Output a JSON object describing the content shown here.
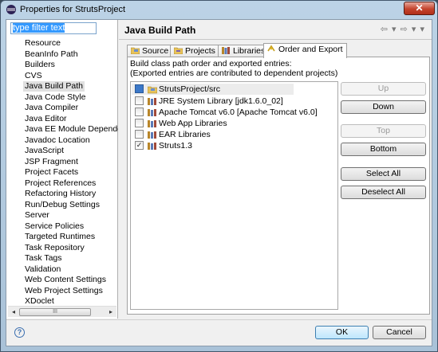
{
  "window": {
    "title": "Properties for StrutsProject",
    "close_glyph": "✕"
  },
  "filter": {
    "value": "type filter text"
  },
  "tree": {
    "items": [
      "Resource",
      "BeanInfo Path",
      "Builders",
      "CVS",
      "Java Build Path",
      "Java Code Style",
      "Java Compiler",
      "Java Editor",
      "Java EE Module Dependencies",
      "Javadoc Location",
      "JavaScript",
      "JSP Fragment",
      "Project Facets",
      "Project References",
      "Refactoring History",
      "Run/Debug Settings",
      "Server",
      "Service Policies",
      "Targeted Runtimes",
      "Task Repository",
      "Task Tags",
      "Validation",
      "Web Content Settings",
      "Web Project Settings",
      "XDoclet"
    ],
    "selected_index": 4
  },
  "scroll": {
    "left": "◂",
    "right": "▸",
    "grip": "III"
  },
  "page": {
    "title": "Java Build Path",
    "nav": "⇦ ▾ ⇨ ▾ ▾"
  },
  "tabs": [
    {
      "label": "Source",
      "icon": "source-folder-icon"
    },
    {
      "label": "Projects",
      "icon": "projects-icon"
    },
    {
      "label": "Libraries",
      "icon": "libraries-icon"
    },
    {
      "label": "Order and Export",
      "icon": "order-export-icon",
      "active": true
    }
  ],
  "description": {
    "line1": "Build class path order and exported entries:",
    "line2": "(Exported entries are contributed to dependent projects)"
  },
  "entries": [
    {
      "label": "StrutsProject/src",
      "icon": "source-folder-icon",
      "checked": true,
      "selected": true
    },
    {
      "label": "JRE System Library [jdk1.6.0_02]",
      "icon": "library-icon",
      "checked": false
    },
    {
      "label": "Apache Tomcat v6.0 [Apache Tomcat v6.0]",
      "icon": "library-icon",
      "checked": false
    },
    {
      "label": "Web App Libraries",
      "icon": "library-icon",
      "checked": false
    },
    {
      "label": "EAR Libraries",
      "icon": "library-icon",
      "checked": false
    },
    {
      "label": "Struts1.3",
      "icon": "library-icon",
      "checked": true
    }
  ],
  "buttons": {
    "up": "Up",
    "down": "Down",
    "top": "Top",
    "bottom": "Bottom",
    "select_all": "Select All",
    "deselect_all": "Deselect All"
  },
  "footer": {
    "help": "?",
    "ok": "OK",
    "cancel": "Cancel"
  },
  "colors": {
    "titlebar": "#bcd3e6",
    "selection": "#3399ff",
    "ok_border": "#3c7fb1"
  }
}
